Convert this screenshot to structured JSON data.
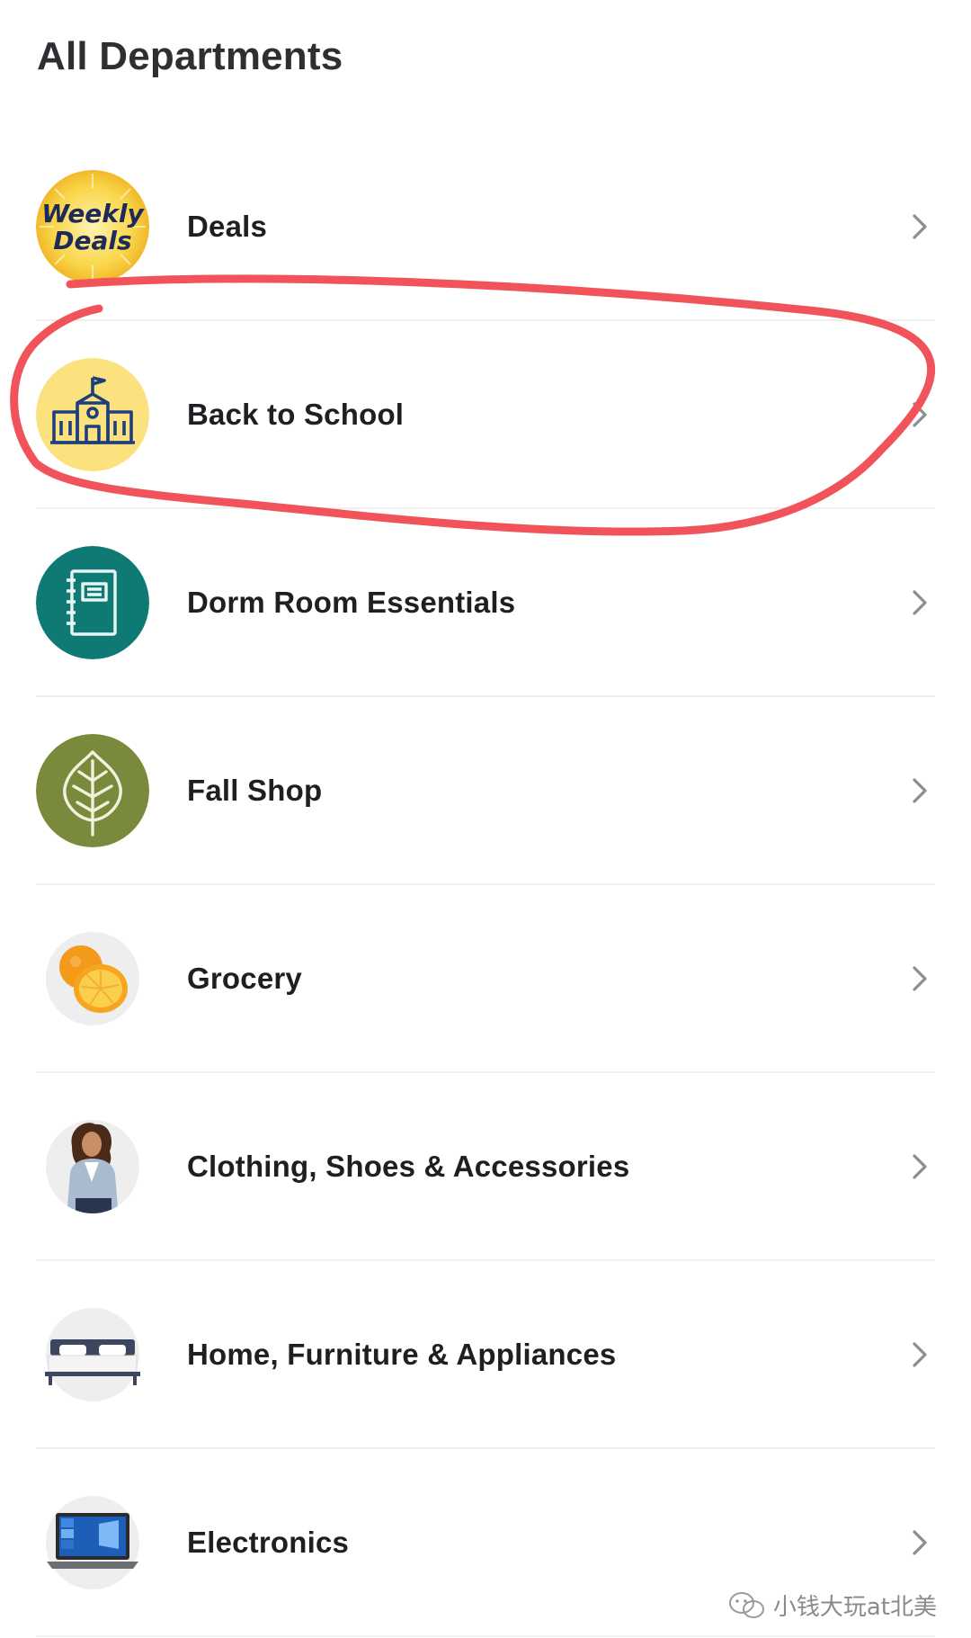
{
  "page": {
    "title": "All Departments"
  },
  "departments": [
    {
      "label": "Deals",
      "icon": "weekly-deals-badge",
      "badge_text_1": "Weekly",
      "badge_text_2": "Deals"
    },
    {
      "label": "Back to School",
      "icon": "school-building-icon"
    },
    {
      "label": "Dorm Room Essentials",
      "icon": "notebook-icon"
    },
    {
      "label": "Fall Shop",
      "icon": "leaf-icon"
    },
    {
      "label": "Grocery",
      "icon": "oranges-image"
    },
    {
      "label": "Clothing, Shoes & Accessories",
      "icon": "model-image"
    },
    {
      "label": "Home, Furniture & Appliances",
      "icon": "bed-image"
    },
    {
      "label": "Electronics",
      "icon": "laptop-image"
    }
  ],
  "watermark": {
    "text": "小钱大玩at北美"
  },
  "colors": {
    "annotation_red": "#f0545a",
    "deals_yellow": "#f6c935",
    "school_yellow": "#fbe27e",
    "dorm_teal": "#0f7a73",
    "fall_olive": "#7a8a3c",
    "chevron_gray": "#8b8d91"
  }
}
